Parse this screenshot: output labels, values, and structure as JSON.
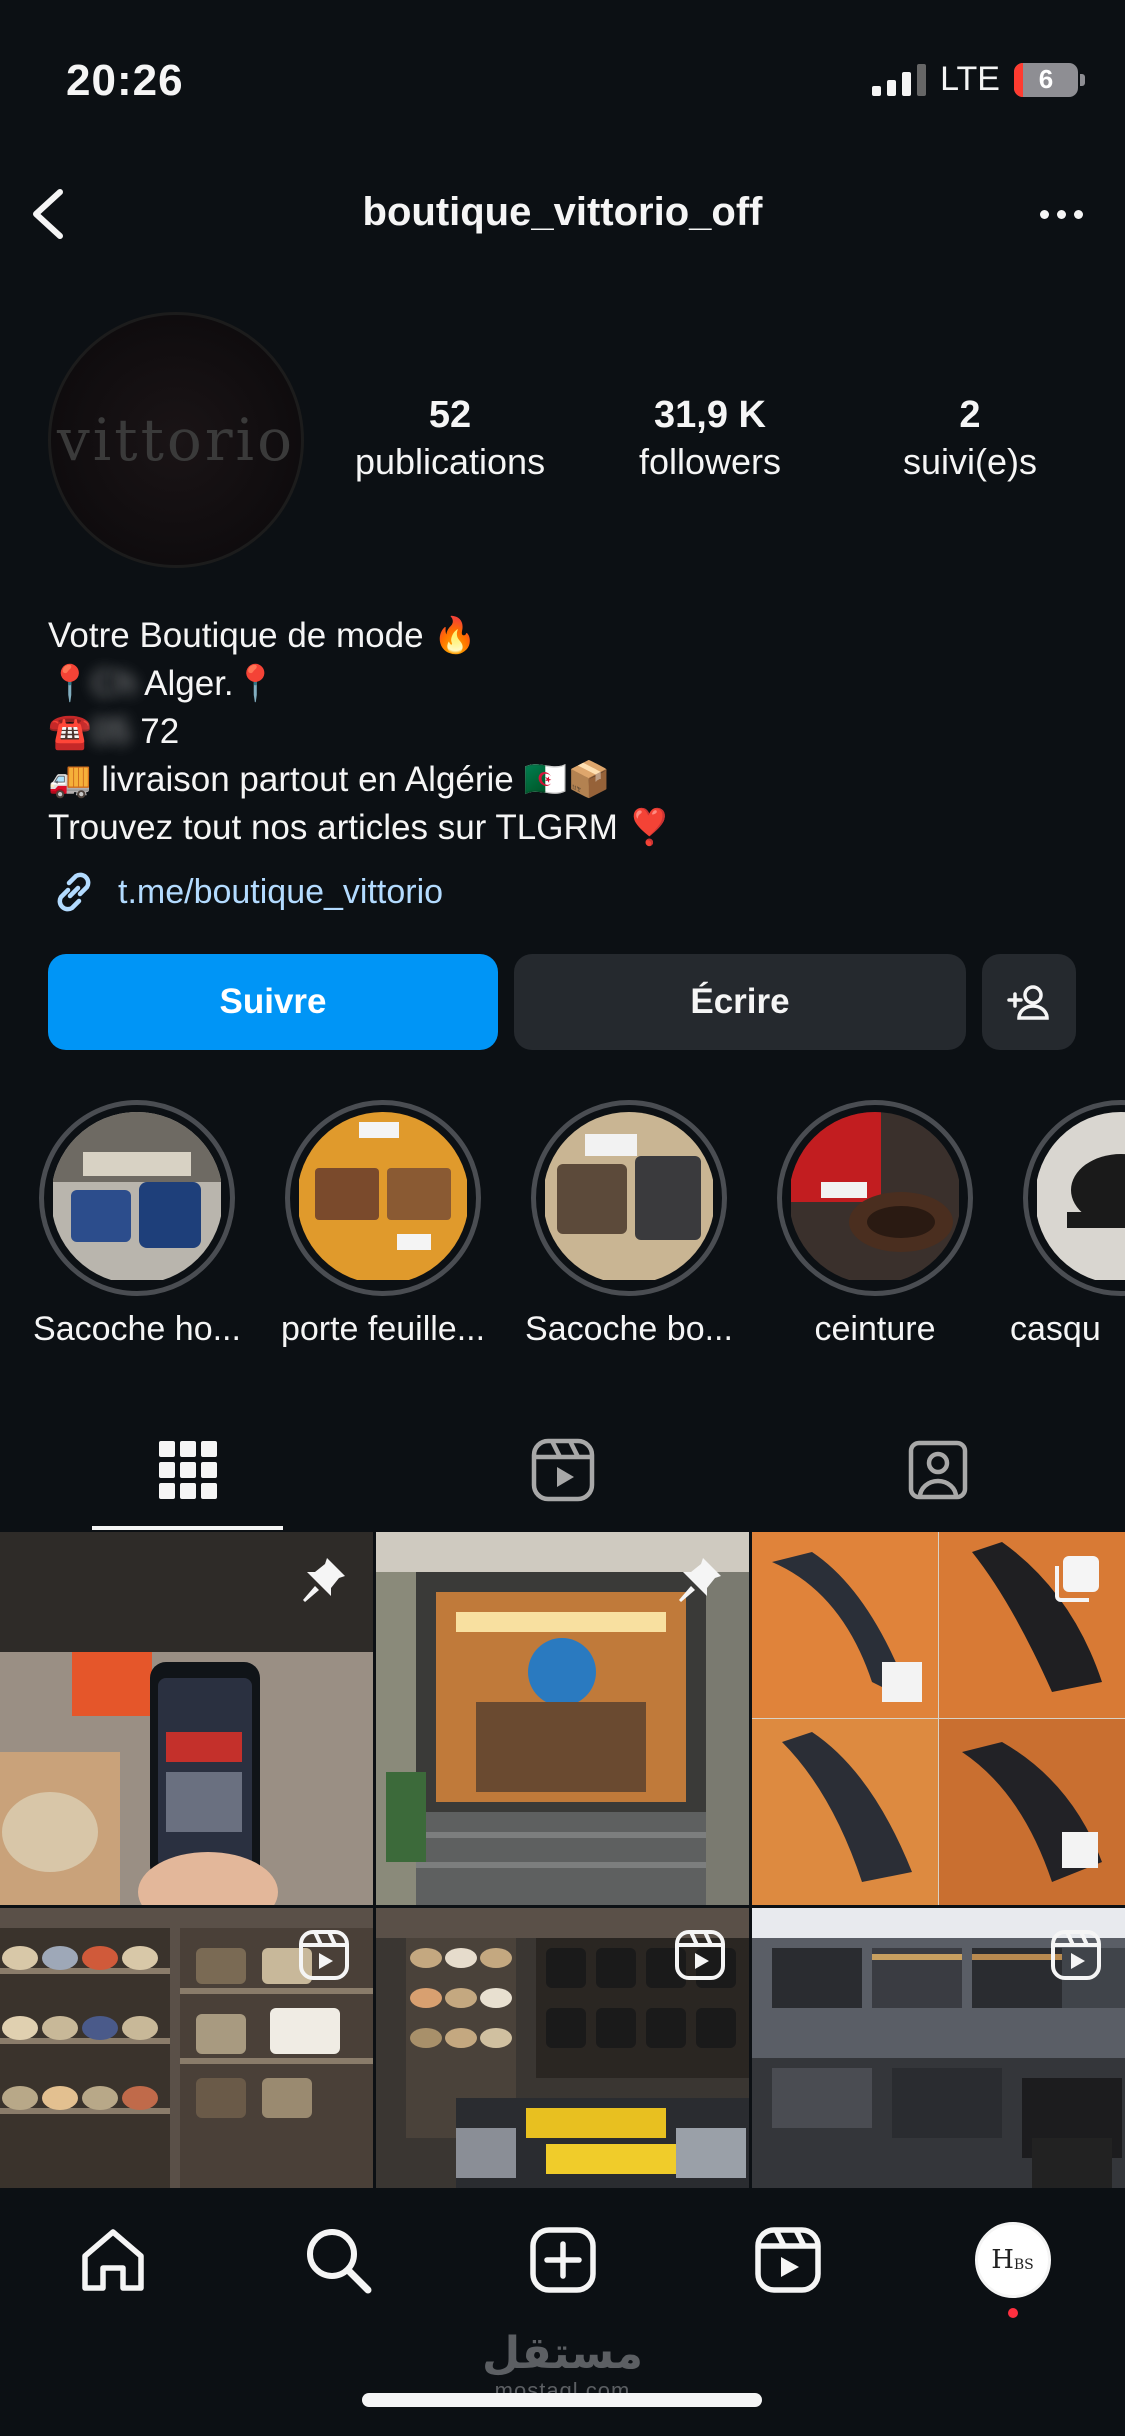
{
  "status_bar": {
    "time": "20:26",
    "network": "LTE",
    "battery": "6"
  },
  "header": {
    "username": "boutique_vittorio_off",
    "back_icon": "chevron-left-icon",
    "more_icon": "more-horizontal-icon"
  },
  "profile": {
    "avatar_text": "vittorio",
    "stats": [
      {
        "value": "52",
        "label": "publications"
      },
      {
        "value": "31,9 K",
        "label": "followers"
      },
      {
        "value": "2",
        "label": "suivi(e)s"
      }
    ],
    "bio": {
      "line1": "Votre Boutique de mode 🔥",
      "line2_prefix": "📍",
      "line2_redacted": "Ch",
      "line2_suffix": "Alger.📍",
      "line3_prefix": "☎️",
      "line3_redacted": "05",
      "line3_suffix": "72",
      "line4": "🚚 livraison partout en Algérie 🇩🇿📦",
      "line5": "Trouvez tout nos articles sur TLGRM ❣️"
    },
    "link": "t.me/boutique_vittorio"
  },
  "actions": {
    "follow": "Suivre",
    "message": "Écrire",
    "add_user_icon": "add-person-icon"
  },
  "highlights": [
    {
      "label": "Sacoche ho..."
    },
    {
      "label": "porte feuille..."
    },
    {
      "label": "Sacoche bo..."
    },
    {
      "label": "ceinture"
    },
    {
      "label": "casqu"
    }
  ],
  "tabs": [
    {
      "name": "grid",
      "icon": "grid-icon",
      "active": true
    },
    {
      "name": "reels",
      "icon": "reels-icon",
      "active": false
    },
    {
      "name": "tagged",
      "icon": "tagged-user-icon",
      "active": false
    }
  ],
  "posts": [
    {
      "badge": "pin-icon"
    },
    {
      "badge": "pin-icon"
    },
    {
      "badge": "carousel-icon"
    },
    {
      "badge": "reel-icon"
    },
    {
      "badge": "reel-icon"
    },
    {
      "badge": "reel-icon"
    }
  ],
  "bottom_nav": [
    "home-icon",
    "search-icon",
    "create-icon",
    "reels-icon",
    "profile-avatar"
  ],
  "profile_nav_avatar_text": "H",
  "profile_nav_avatar_sub": "BS",
  "watermark": {
    "arabic": "مستقل",
    "latin": "mostaql.com"
  },
  "colors": {
    "background": "#0c1014",
    "accent": "#0095f6",
    "link": "#b3dbff",
    "button": "#25292e"
  }
}
